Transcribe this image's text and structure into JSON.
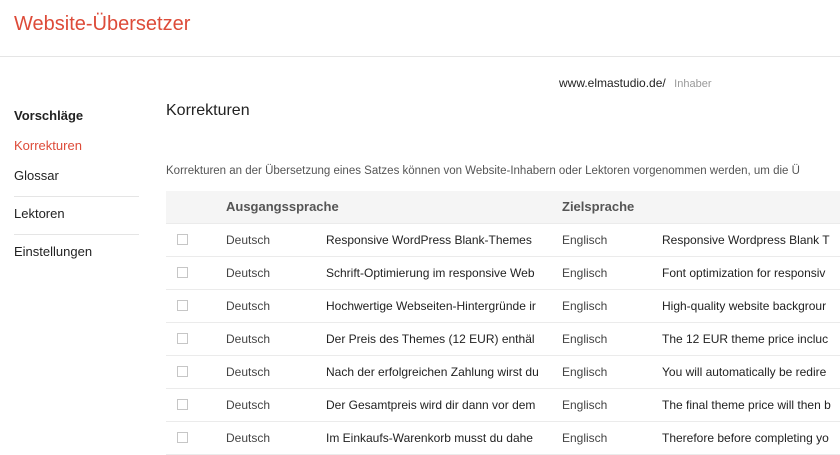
{
  "app": {
    "title": "Website-Übersetzer"
  },
  "site": {
    "url": "www.elmastudio.de/",
    "role": "Inhaber"
  },
  "sidebar": {
    "heading": "Vorschläge",
    "items": [
      {
        "label": "Korrekturen"
      },
      {
        "label": "Glossar"
      },
      {
        "label": "Lektoren"
      },
      {
        "label": "Einstellungen"
      }
    ],
    "active": "Korrekturen"
  },
  "main": {
    "title": "Korrekturen",
    "description": "Korrekturen an der Übersetzung eines Satzes können von Website-Inhabern oder Lektoren vorgenommen werden, um die Ü"
  },
  "table": {
    "headers": {
      "source_language": "Ausgangssprache",
      "target_language": "Zielsprache"
    },
    "rows": [
      {
        "src_lang": "Deutsch",
        "src_text": "Responsive WordPress Blank-Themes",
        "tgt_lang": "Englisch",
        "tgt_text": "Responsive Wordpress Blank T"
      },
      {
        "src_lang": "Deutsch",
        "src_text": "Schrift-Optimierung im responsive Web",
        "tgt_lang": "Englisch",
        "tgt_text": "Font optimization for responsiv"
      },
      {
        "src_lang": "Deutsch",
        "src_text": "Hochwertige Webseiten-Hintergründe ir",
        "tgt_lang": "Englisch",
        "tgt_text": "High-quality website backgrour"
      },
      {
        "src_lang": "Deutsch",
        "src_text": "Der Preis des Themes (12 EUR) enthäl",
        "tgt_lang": "Englisch",
        "tgt_text": "The 12 EUR theme price incluc"
      },
      {
        "src_lang": "Deutsch",
        "src_text": "Nach der erfolgreichen Zahlung wirst du",
        "tgt_lang": "Englisch",
        "tgt_text": "You will automatically be redire"
      },
      {
        "src_lang": "Deutsch",
        "src_text": "Der Gesamtpreis wird dir dann vor dem",
        "tgt_lang": "Englisch",
        "tgt_text": "The final theme price will then b"
      },
      {
        "src_lang": "Deutsch",
        "src_text": "Im Einkaufs-Warenkorb musst du dahe",
        "tgt_lang": "Englisch",
        "tgt_text": "Therefore before completing yo"
      }
    ]
  },
  "colors": {
    "accent": "#dd4b39",
    "header_bg": "#f5f5f5",
    "divider": "#e5e5e5"
  }
}
